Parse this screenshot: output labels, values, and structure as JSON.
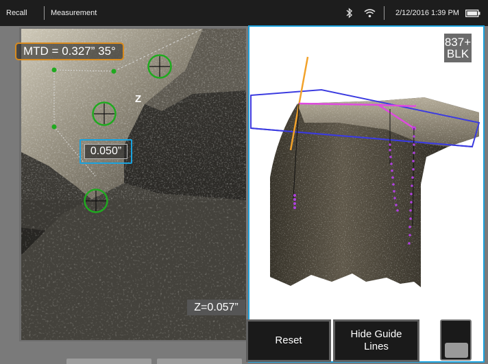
{
  "statusbar": {
    "app_name": "Recall",
    "mode": "Measurement",
    "datetime": "2/12/2016  1:39 PM",
    "icons": [
      "bluetooth-icon",
      "wifi-icon",
      "battery-icon"
    ]
  },
  "image_view": {
    "measurement_label": "MTD = 0.327” 35°",
    "depth_value": "0.050”",
    "axis_marker": "Z",
    "z_readout": "Z=0.057”",
    "accent_orange": "#d98b1e",
    "accent_blue": "#1aa3df",
    "cursor_color": "#1faa1f"
  },
  "point_cloud_view": {
    "tip_badge_line1": "837+",
    "tip_badge_line2": "BLK"
  },
  "controls": {
    "reset_label": "Reset",
    "hide_guide_line1": "Hide Guide",
    "hide_guide_line2": "Lines"
  }
}
